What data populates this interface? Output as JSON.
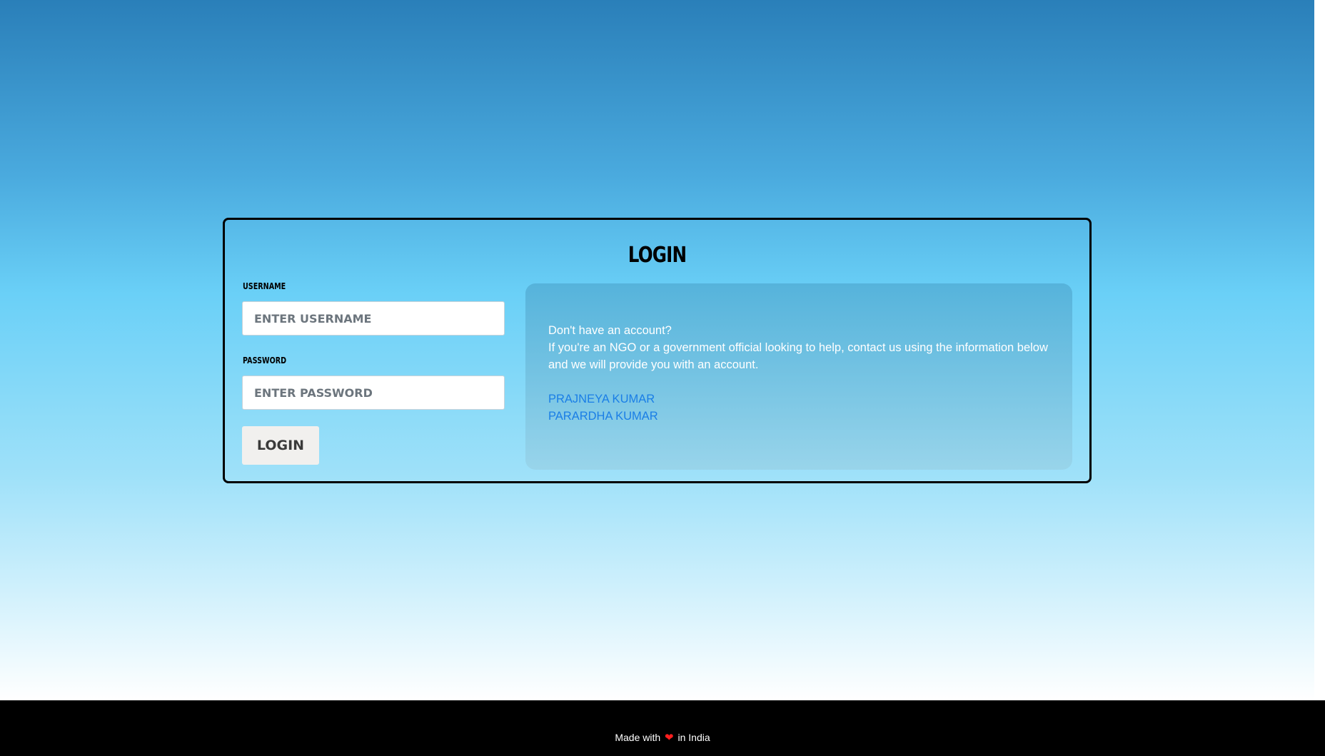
{
  "login": {
    "title": "LOGIN",
    "username_label": "USERNAME",
    "username_placeholder": "ENTER USERNAME",
    "password_label": "PASSWORD",
    "password_placeholder": "ENTER PASSWORD",
    "button_label": "LOGIN"
  },
  "info": {
    "line1": "Don't have an account?",
    "line2": "If you're an NGO or a government official looking to help, contact us using the information below and we will provide you with an account.",
    "contacts": [
      {
        "label": "PRAJNEYA KUMAR"
      },
      {
        "label": "PARARDHA KUMAR"
      }
    ]
  },
  "footer": {
    "prefix": "Made with",
    "heart_icon": "heart-icon",
    "suffix": "in India"
  },
  "colors": {
    "link": "#1a7ee6",
    "heart": "#ff1e1e",
    "footer_bg": "#000000"
  }
}
